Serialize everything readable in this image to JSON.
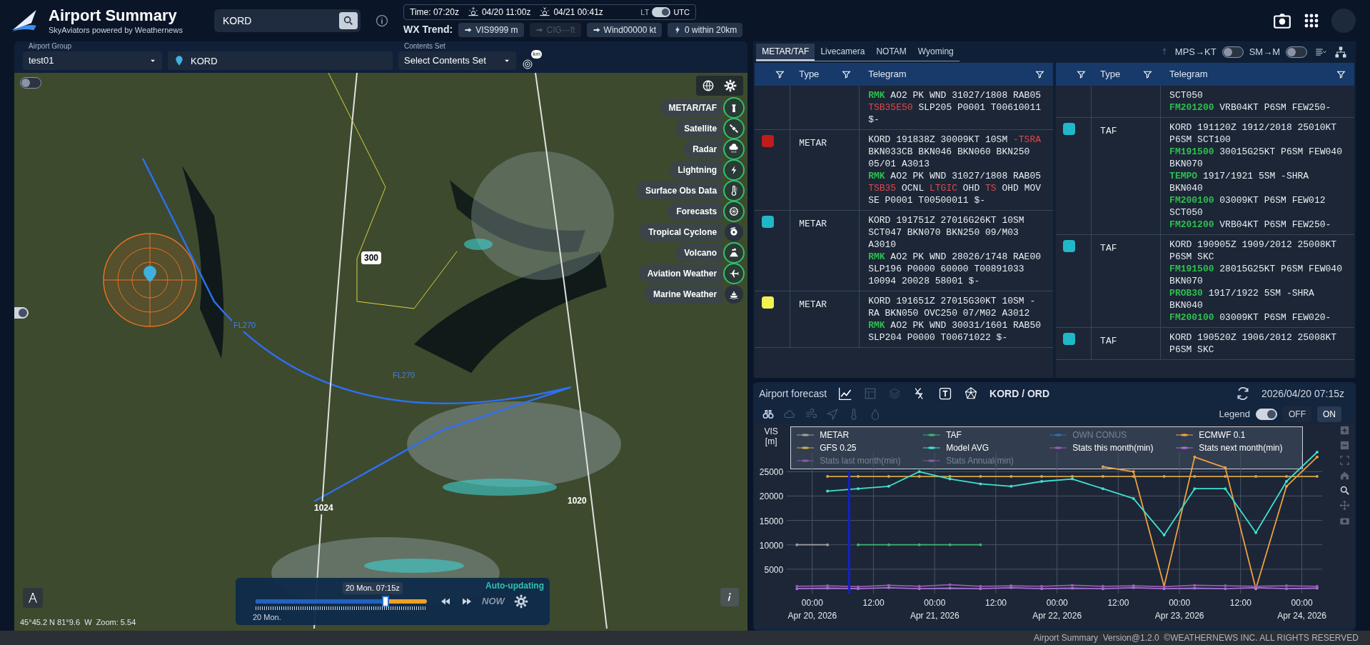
{
  "header": {
    "title": "Airport Summary",
    "subtitle": "SkyAviators powered by Weathernews",
    "search": {
      "value": "KORD"
    },
    "time": "Time: 07:20z",
    "sunrise": "04/20 11:00z",
    "sunset": "04/21 00:41z",
    "clock_toggle": [
      {
        "label": "LT",
        "selected": false
      },
      {
        "label": "UTC",
        "selected": true
      }
    ],
    "wx_trend_label": "WX Trend:",
    "trend_chips": [
      {
        "label": "VIS9999 m",
        "disabled": false
      },
      {
        "label": "CIG---ft",
        "disabled": true
      },
      {
        "label": "Wind00000 kt",
        "disabled": false
      },
      {
        "label": "0 within 20km",
        "disabled": false,
        "kind": "lightning"
      }
    ]
  },
  "map_toolbar": {
    "airport_group": {
      "label": "Airport Group",
      "value": "test01"
    },
    "airport": {
      "value": "KORD"
    },
    "contents_set": {
      "label": "Contents Set",
      "value": "Select Contents Set"
    },
    "range_unit": "km"
  },
  "map": {
    "top_toggle": {
      "on": false
    },
    "bottom_toggle": {
      "on": true
    },
    "labels": [
      {
        "kind": "altitude",
        "text": "300"
      },
      {
        "kind": "route",
        "text": "FL270"
      },
      {
        "kind": "route",
        "text": "FL270"
      },
      {
        "kind": "isobar",
        "text": "1024"
      },
      {
        "kind": "isobar",
        "text": "1020"
      }
    ],
    "layers": [
      {
        "name": "METAR/TAF",
        "kind": "tower",
        "on": true
      },
      {
        "name": "Satellite",
        "kind": "satellite",
        "on": true
      },
      {
        "name": "Radar",
        "kind": "radar",
        "on": true
      },
      {
        "name": "Lightning",
        "kind": "lightning",
        "on": true
      },
      {
        "name": "Surface Obs Data",
        "kind": "thermometer",
        "on": true
      },
      {
        "name": "Forecasts",
        "kind": "forecast",
        "on": true
      },
      {
        "name": "Tropical Cyclone",
        "kind": "cyclone",
        "on": false
      },
      {
        "name": "Volcano",
        "kind": "volcano",
        "on": true
      },
      {
        "name": "Aviation Weather",
        "kind": "aviation",
        "on": true
      },
      {
        "name": "Marine Weather",
        "kind": "marine",
        "on": false
      }
    ],
    "timeline": {
      "current": "20 Mon. 07:15z",
      "start": "20 Mon.",
      "status": "Auto-updating",
      "now": "NOW",
      "level": 0.76
    },
    "coords": "45°45.2 N 81°9.6  W  Zoom: 5.54"
  },
  "right_tabs": [
    {
      "label": "METAR/TAF",
      "selected": true
    },
    {
      "label": "Livecamera",
      "selected": false
    },
    {
      "label": "NOTAM",
      "selected": false
    },
    {
      "label": "Wyoming",
      "selected": false
    }
  ],
  "unit_toggles": [
    {
      "label": "MPS→KT",
      "on": false
    },
    {
      "label": "SM→M",
      "on": false
    }
  ],
  "tables": [
    {
      "columns": [
        "Type",
        "Telegram"
      ],
      "rows": [
        {
          "color": null,
          "type": "",
          "telegram": [
            [
              {
                "kind": "keyword",
                "text": "RMK"
              },
              {
                "kind": "plain",
                "text": " AO2 PK WND 31027/1808 RAB05 "
              },
              {
                "kind": "alert",
                "text": "TSB35E50"
              },
              {
                "kind": "plain",
                "text": " SLP205 P0001 T00610011 $-"
              }
            ]
          ]
        },
        {
          "color": "#c01c1c",
          "type": "METAR",
          "telegram": [
            [
              {
                "kind": "plain",
                "text": "KORD 191838Z 30009KT 10SM "
              },
              {
                "kind": "alert",
                "text": "-TSRA"
              },
              {
                "kind": "plain",
                "text": " BKN033CB BKN046 BKN060 BKN250 05/01 A3013"
              }
            ],
            [
              {
                "kind": "keyword",
                "text": "RMK"
              },
              {
                "kind": "plain",
                "text": " AO2 PK WND 31027/1808 RAB05 "
              },
              {
                "kind": "alert",
                "text": "TSB35"
              },
              {
                "kind": "plain",
                "text": " OCNL "
              },
              {
                "kind": "alert",
                "text": "LTGIC"
              },
              {
                "kind": "plain",
                "text": " OHD "
              },
              {
                "kind": "alert",
                "text": "TS"
              },
              {
                "kind": "plain",
                "text": " OHD MOV SE P0001 T00500011 $-"
              }
            ]
          ]
        },
        {
          "color": "#20b8c8",
          "type": "METAR",
          "telegram": [
            [
              {
                "kind": "plain",
                "text": "KORD 191751Z 27016G26KT 10SM SCT047 BKN070 BKN250 09/M03 A3010"
              }
            ],
            [
              {
                "kind": "keyword",
                "text": "RMK"
              },
              {
                "kind": "plain",
                "text": " AO2 PK WND 28026/1748 RAE00 SLP196 P0000 60000 T00891033 10094 20028 58001 $-"
              }
            ]
          ]
        },
        {
          "color": "#f2f250",
          "type": "METAR",
          "telegram": [
            [
              {
                "kind": "plain",
                "text": "KORD 191651Z 27015G30KT 10SM -RA BKN050 OVC250 07/M02 A3012"
              }
            ],
            [
              {
                "kind": "keyword",
                "text": "RMK"
              },
              {
                "kind": "plain",
                "text": " AO2 PK WND 30031/1601 RAB50 SLP204 P0000 T00671022 $-"
              }
            ]
          ]
        }
      ]
    },
    {
      "columns": [
        "Type",
        "Telegram"
      ],
      "rows": [
        {
          "color": null,
          "type": "",
          "telegram": [
            [
              {
                "kind": "plain",
                "text": "SCT050"
              }
            ],
            [
              {
                "kind": "keyword",
                "text": "FM201200"
              },
              {
                "kind": "plain",
                "text": " VRB04KT P6SM FEW250-"
              }
            ]
          ]
        },
        {
          "color": "#20b8c8",
          "type": "TAF",
          "telegram": [
            [
              {
                "kind": "plain",
                "text": "KORD 191120Z 1912/2018 25010KT P6SM SCT100"
              }
            ],
            [
              {
                "kind": "keyword",
                "text": "FM191500"
              },
              {
                "kind": "plain",
                "text": " 30015G25KT P6SM FEW040 BKN070"
              }
            ],
            [
              {
                "kind": "keyword",
                "text": "TEMPO"
              },
              {
                "kind": "plain",
                "text": " 1917/1921 5SM -SHRA BKN040"
              }
            ],
            [
              {
                "kind": "keyword",
                "text": "FM200100"
              },
              {
                "kind": "plain",
                "text": " 03009KT P6SM FEW012 SCT050"
              }
            ],
            [
              {
                "kind": "keyword",
                "text": "FM201200"
              },
              {
                "kind": "plain",
                "text": " VRB04KT P6SM FEW250-"
              }
            ]
          ]
        },
        {
          "color": "#20b8c8",
          "type": "TAF",
          "telegram": [
            [
              {
                "kind": "plain",
                "text": "KORD 190905Z 1909/2012 25008KT P6SM SKC"
              }
            ],
            [
              {
                "kind": "keyword",
                "text": "FM191500"
              },
              {
                "kind": "plain",
                "text": " 28015G25KT P6SM FEW040 BKN070"
              }
            ],
            [
              {
                "kind": "keyword",
                "text": "PROB30"
              },
              {
                "kind": "plain",
                "text": " 1917/1922 5SM -SHRA BKN040"
              }
            ],
            [
              {
                "kind": "keyword",
                "text": "FM200100"
              },
              {
                "kind": "plain",
                "text": " 03009KT P6SM FEW020-"
              }
            ]
          ]
        },
        {
          "color": "#20b8c8",
          "type": "TAF",
          "telegram": [
            [
              {
                "kind": "plain",
                "text": "KORD 190520Z 1906/2012 25008KT P6SM SKC"
              }
            ]
          ]
        }
      ]
    }
  ],
  "forecast": {
    "title": "Airport forecast",
    "airport": "KORD / ORD",
    "time": "2026/04/20 07:15z",
    "legend_label": "Legend",
    "legend_on": true,
    "legend_buttons": [
      {
        "label": "OFF",
        "selected": false
      },
      {
        "label": "ON",
        "selected": true
      }
    ],
    "chart_data": {
      "type": "line",
      "ylabel": "VIS [m]",
      "grid": true,
      "x": [
        "2026-04-19T21:00",
        "2026-04-20T03:00",
        "2026-04-20T09:00",
        "2026-04-20T15:00",
        "2026-04-20T21:00",
        "2026-04-21T03:00",
        "2026-04-21T09:00",
        "2026-04-21T15:00",
        "2026-04-21T21:00",
        "2026-04-22T03:00",
        "2026-04-22T09:00",
        "2026-04-22T15:00",
        "2026-04-22T21:00",
        "2026-04-23T03:00",
        "2026-04-23T09:00",
        "2026-04-23T15:00",
        "2026-04-23T21:00",
        "2026-04-24T03:00"
      ],
      "xlim": [
        "2026-04-19T19:00",
        "2026-04-24T04:00"
      ],
      "ylim": [
        0,
        29000
      ],
      "xticks": [
        {
          "value": "2026-04-20T00:00",
          "label": "00:00\nApr 20, 2026"
        },
        {
          "value": "2026-04-20T12:00",
          "label": "12:00"
        },
        {
          "value": "2026-04-21T00:00",
          "label": "00:00\nApr 21, 2026"
        },
        {
          "value": "2026-04-21T12:00",
          "label": "12:00"
        },
        {
          "value": "2026-04-22T00:00",
          "label": "00:00\nApr 22, 2026"
        },
        {
          "value": "2026-04-22T12:00",
          "label": "12:00"
        },
        {
          "value": "2026-04-23T00:00",
          "label": "00:00\nApr 23, 2026"
        },
        {
          "value": "2026-04-23T12:00",
          "label": "12:00"
        },
        {
          "value": "2026-04-24T00:00",
          "label": "00:00\nApr 24, 2026"
        }
      ],
      "yticks": [
        5000,
        10000,
        15000,
        20000,
        25000
      ],
      "legend": {
        "enabled": [
          true,
          true,
          false,
          true,
          true,
          true,
          true,
          true,
          false,
          false
        ]
      },
      "series": [
        {
          "name": "METAR",
          "color": "#9e9e9e",
          "values": [
            10000,
            10000,
            null,
            null,
            null,
            null,
            null,
            null,
            null,
            null,
            null,
            null,
            null,
            null,
            null,
            null,
            null,
            null
          ]
        },
        {
          "name": "TAF",
          "color": "#3cb371",
          "values": [
            null,
            null,
            10000,
            10000,
            10000,
            10000,
            10000,
            null,
            null,
            null,
            null,
            null,
            null,
            null,
            null,
            null,
            null,
            null
          ]
        },
        {
          "name": "OWN CONUS",
          "color": "#2f6fa8",
          "values": [
            null,
            null,
            null,
            null,
            null,
            null,
            null,
            null,
            null,
            null,
            null,
            null,
            null,
            null,
            null,
            null,
            null,
            null
          ]
        },
        {
          "name": "ECMWF 0.1",
          "color": "#f0a040",
          "values": [
            null,
            null,
            null,
            null,
            null,
            null,
            null,
            null,
            null,
            null,
            26000,
            25000,
            1500,
            28000,
            25800,
            1000,
            22000,
            28000
          ]
        },
        {
          "name": "GFS 0.25",
          "color": "#d4a64a",
          "values": [
            null,
            24000,
            24000,
            24000,
            24000,
            24000,
            24000,
            24000,
            24000,
            24000,
            24000,
            24000,
            24000,
            24000,
            24000,
            24000,
            24000,
            24000
          ]
        },
        {
          "name": "Model AVG",
          "color": "#40e0d0",
          "values": [
            null,
            21000,
            21500,
            22000,
            25000,
            23500,
            22500,
            22000,
            23000,
            23500,
            21500,
            19500,
            12000,
            21500,
            21500,
            12500,
            23000,
            29000
          ]
        },
        {
          "name": "Stats this month(min)",
          "color": "#9b59b6",
          "values": [
            1500,
            1600,
            1400,
            1700,
            1500,
            1800,
            1500,
            1600,
            1500,
            1700,
            1500,
            1600,
            1400,
            1700,
            1600,
            1500,
            1600,
            1500
          ]
        },
        {
          "name": "Stats next month(min)",
          "color": "#a070d0",
          "values": [
            1000,
            1100,
            1000,
            1200,
            1000,
            1100,
            1000,
            1200,
            1000,
            1100,
            1000,
            1200,
            1000,
            1100,
            1000,
            1200,
            1000,
            1100
          ]
        },
        {
          "name": "Stats last month(min)",
          "color": "#7f5fa0",
          "values": [
            null,
            null,
            null,
            null,
            null,
            null,
            null,
            null,
            null,
            null,
            null,
            null,
            null,
            null,
            null,
            null,
            null,
            null
          ]
        },
        {
          "name": "Stats Annual(min)",
          "color": "#7f5fa0",
          "values": [
            null,
            null,
            null,
            null,
            null,
            null,
            null,
            null,
            null,
            null,
            null,
            null,
            null,
            null,
            null,
            null,
            null,
            null
          ]
        }
      ],
      "ref_lines": [
        {
          "axis": "x",
          "value": "2026-04-20T07:15",
          "color": "#1020d0"
        }
      ]
    }
  },
  "footer": "Airport Summary  Version@1.2.0  ©WEATHERNEWS INC. ALL RIGHTS RESERVED"
}
